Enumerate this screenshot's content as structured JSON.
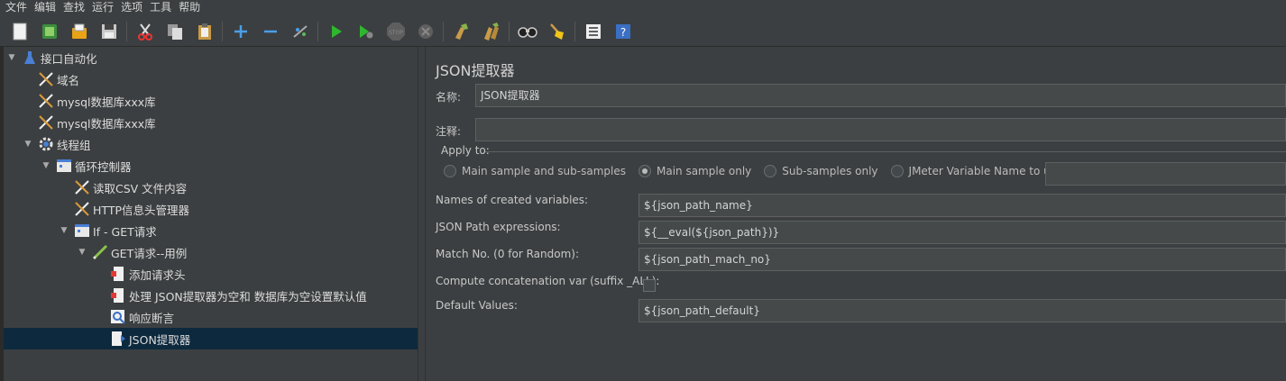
{
  "menu": [
    "文件",
    "编辑",
    "查找",
    "运行",
    "选项",
    "工具",
    "帮助"
  ],
  "tree": {
    "root": "接口自动化",
    "domain": "域名",
    "db1": "mysql数据库xxx库",
    "db2": "mysql数据库xxx库",
    "thread_group": "线程组",
    "loop": "循环控制器",
    "csv": "读取CSV 文件内容",
    "header": "HTTP信息头管理器",
    "if": "If - GET请求",
    "get": "GET请求--用例",
    "add_header": "添加请求头",
    "process": "处理 JSON提取器为空和 数据库为空设置默认值",
    "assert": "响应断言",
    "json": "JSON提取器"
  },
  "panel": {
    "title": "JSON提取器",
    "name_label": "名称:",
    "name_value": "JSON提取器",
    "comment_label": "注释:",
    "comment_value": "",
    "apply_to": "Apply to:",
    "radios": [
      "Main sample and sub-samples",
      "Main sample only",
      "Sub-samples only",
      "JMeter Variable Name to use"
    ],
    "selected_radio": "Main sample only",
    "var_name_value": "",
    "names_label": "Names of created variables:",
    "names_value": "${json_path_name}",
    "expr_label": "JSON Path expressions:",
    "expr_value": "${__eval(${json_path})}",
    "match_label": "Match No. (0 for Random):",
    "match_value": "${json_path_mach_no}",
    "concat_label": "Compute concatenation var (suffix _ALL):",
    "default_label": "Default Values:",
    "default_value": "${json_path_default}"
  }
}
